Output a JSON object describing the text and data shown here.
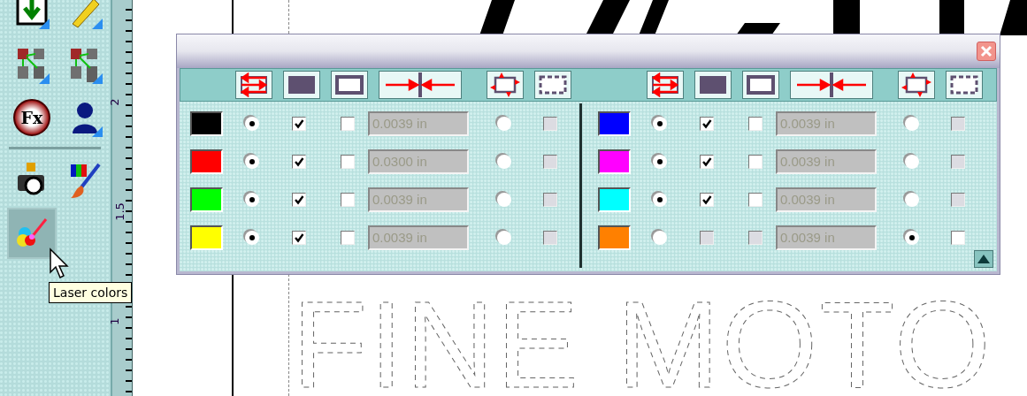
{
  "toolbar": {
    "tool_groups": [
      [
        {
          "kind": "download",
          "selected": false
        },
        {
          "kind": "pencil",
          "selected": false
        },
        {
          "kind": "network",
          "selected": false
        },
        {
          "kind": "server",
          "selected": false
        },
        {
          "kind": "fx",
          "label": "Fx",
          "selected": false
        },
        {
          "kind": "person",
          "selected": false
        }
      ],
      [
        {
          "kind": "camera",
          "selected": false
        },
        {
          "kind": "palette",
          "selected": false
        },
        {
          "kind": "laser",
          "selected": true
        }
      ]
    ]
  },
  "tooltip": "Laser colors",
  "ruler": {
    "labels": [
      "2",
      "1.5",
      "1"
    ]
  },
  "canvas": {
    "outline_text": "FINE MOTO"
  },
  "color_panels": [
    {
      "rows": [
        {
          "color": "#000000",
          "radio_a": {
            "selected": true
          },
          "check_a": {
            "checked": true,
            "disabled": false
          },
          "check_b": {
            "checked": false,
            "disabled": false
          },
          "width": "0.0039 in",
          "radio_b": {
            "selected": false
          },
          "check_c": {
            "checked": false,
            "disabled": true
          }
        },
        {
          "color": "#ff0000",
          "radio_a": {
            "selected": true
          },
          "check_a": {
            "checked": true,
            "disabled": false
          },
          "check_b": {
            "checked": false,
            "disabled": false
          },
          "width": "0.0300 in",
          "radio_b": {
            "selected": false
          },
          "check_c": {
            "checked": false,
            "disabled": true
          }
        },
        {
          "color": "#00ff00",
          "radio_a": {
            "selected": true
          },
          "check_a": {
            "checked": true,
            "disabled": false
          },
          "check_b": {
            "checked": false,
            "disabled": false
          },
          "width": "0.0039 in",
          "radio_b": {
            "selected": false
          },
          "check_c": {
            "checked": false,
            "disabled": true
          }
        },
        {
          "color": "#ffff00",
          "radio_a": {
            "selected": true
          },
          "check_a": {
            "checked": true,
            "disabled": false
          },
          "check_b": {
            "checked": false,
            "disabled": false
          },
          "width": "0.0039 in",
          "radio_b": {
            "selected": false
          },
          "check_c": {
            "checked": false,
            "disabled": true
          }
        }
      ]
    },
    {
      "rows": [
        {
          "color": "#0000ff",
          "radio_a": {
            "selected": true
          },
          "check_a": {
            "checked": true,
            "disabled": false
          },
          "check_b": {
            "checked": false,
            "disabled": false
          },
          "width": "0.0039 in",
          "radio_b": {
            "selected": false
          },
          "check_c": {
            "checked": false,
            "disabled": true
          }
        },
        {
          "color": "#ff00ff",
          "radio_a": {
            "selected": true
          },
          "check_a": {
            "checked": true,
            "disabled": false
          },
          "check_b": {
            "checked": false,
            "disabled": false
          },
          "width": "0.0039 in",
          "radio_b": {
            "selected": false
          },
          "check_c": {
            "checked": false,
            "disabled": true
          }
        },
        {
          "color": "#00ffff",
          "radio_a": {
            "selected": true
          },
          "check_a": {
            "checked": true,
            "disabled": false
          },
          "check_b": {
            "checked": false,
            "disabled": false
          },
          "width": "0.0039 in",
          "radio_b": {
            "selected": false
          },
          "check_c": {
            "checked": false,
            "disabled": true
          }
        },
        {
          "color": "#ff8000",
          "radio_a": {
            "selected": false
          },
          "check_a": {
            "checked": false,
            "disabled": true
          },
          "check_b": {
            "checked": false,
            "disabled": true
          },
          "width": "0.0039 in",
          "radio_b": {
            "selected": true
          },
          "check_c": {
            "checked": false,
            "disabled": false
          }
        }
      ]
    }
  ]
}
